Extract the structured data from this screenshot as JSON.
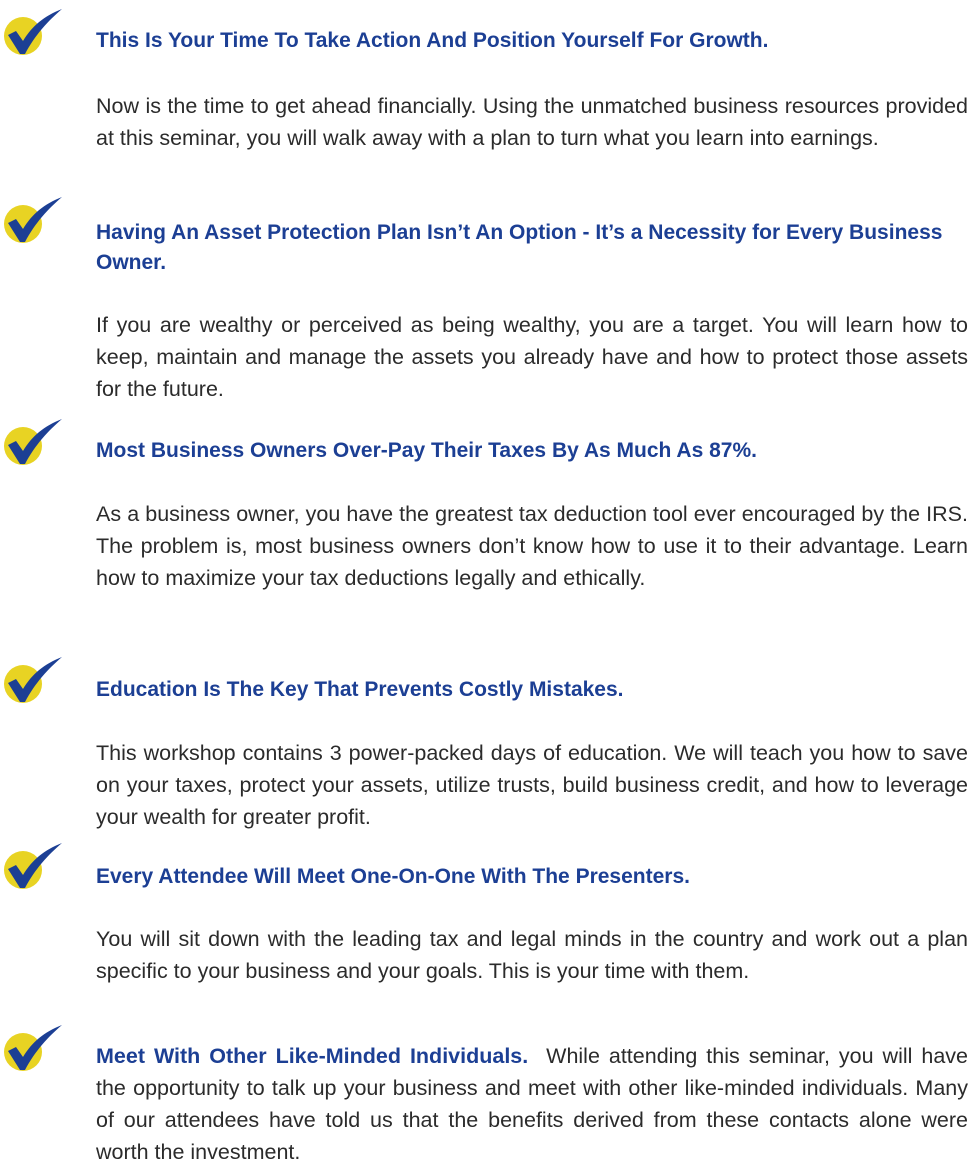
{
  "icon": {
    "name": "checkmark-icon",
    "circle_color": "#e8d323",
    "check_color": "#1c3f94"
  },
  "colors": {
    "heading": "#1c3f94",
    "body": "#2b2b2b"
  },
  "items": [
    {
      "heading": "This Is Your Time To Take Action And Position Yourself For Growth.",
      "body": "Now is the time to get ahead financially. Using the unmatched business resources provided at this seminar, you will walk away with a plan to turn what you learn into earnings."
    },
    {
      "heading": "Having An Asset Protection Plan Isn’t An Option - It’s a Necessity for Every Business Owner.",
      "body": "If you are wealthy or perceived as being wealthy, you are a target. You will learn how to keep, maintain and manage the assets you already have and how to protect those assets for the future."
    },
    {
      "heading": "Most Business Owners Over-Pay Their Taxes By As Much As 87%.",
      "body": "As a business owner, you have the greatest tax deduction tool ever encouraged by the IRS. The problem is, most business owners don’t know how to use it to their advantage. Learn how to maximize your tax deductions legally and ethically."
    },
    {
      "heading": "Education Is The Key That Prevents Costly Mistakes.",
      "body": "This workshop contains 3 power-packed days of education. We will teach you how to save on your taxes, protect your assets, utilize trusts, build business credit, and how to leverage your wealth for greater profit."
    },
    {
      "heading": "Every Attendee Will Meet One-On-One With The Presenters.",
      "body": "You will sit down with the leading tax and legal minds in the country and work out a plan specific to your business and your goals. This is your time with them."
    },
    {
      "heading": "Meet With Other Like-Minded Individuals.",
      "body": "While attending this seminar, you will have the opportunity to talk up your business and meet with other like-minded individuals. Many of our attendees have told us that the benefits derived from these contacts alone were worth the investment."
    }
  ]
}
